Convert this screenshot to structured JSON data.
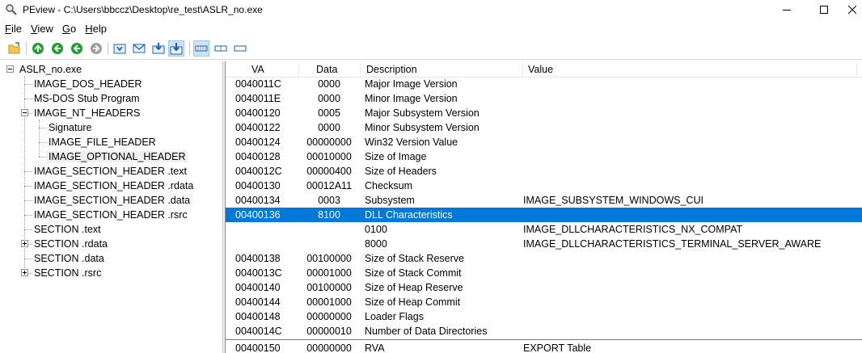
{
  "window": {
    "title": "PEview - C:\\Users\\bbccz\\Desktop\\re_test\\ASLR_no.exe"
  },
  "menu": [
    {
      "label_pre": "",
      "accel": "F",
      "label_post": "ile"
    },
    {
      "label_pre": "",
      "accel": "V",
      "label_post": "iew"
    },
    {
      "label_pre": "",
      "accel": "G",
      "label_post": "o"
    },
    {
      "label_pre": "",
      "accel": "H",
      "label_post": "elp"
    }
  ],
  "toolbar": {
    "icons": [
      "open-folder-icon",
      "go-first-icon",
      "go-back-icon",
      "go-forward-icon",
      "go-last-icon",
      "view-download-icon",
      "view-mail-icon",
      "view-import-icon",
      "view-export-icon",
      "view-bytes-icon",
      "view-words-icon",
      "view-dwords-icon"
    ],
    "accent_color": "#1e9e2e"
  },
  "tree": [
    {
      "label": "ASLR_no.exe",
      "selected": false
    },
    {
      "label": "IMAGE_DOS_HEADER",
      "selected": false
    },
    {
      "label": "MS-DOS Stub Program",
      "selected": false
    },
    {
      "label": "IMAGE_NT_HEADERS",
      "selected": false
    },
    {
      "label": "Signature",
      "selected": false
    },
    {
      "label": "IMAGE_FILE_HEADER",
      "selected": false
    },
    {
      "label": "IMAGE_OPTIONAL_HEADER",
      "selected": true
    },
    {
      "label": "IMAGE_SECTION_HEADER .text",
      "selected": false
    },
    {
      "label": "IMAGE_SECTION_HEADER .rdata",
      "selected": false
    },
    {
      "label": "IMAGE_SECTION_HEADER .data",
      "selected": false
    },
    {
      "label": "IMAGE_SECTION_HEADER .rsrc",
      "selected": false
    },
    {
      "label": "SECTION .text",
      "selected": false
    },
    {
      "label": "SECTION .rdata",
      "selected": false
    },
    {
      "label": "SECTION .data",
      "selected": false
    },
    {
      "label": "SECTION .rsrc",
      "selected": false
    }
  ],
  "table": {
    "headers": {
      "va": "VA",
      "data": "Data",
      "description": "Description",
      "value": "Value"
    },
    "selection_color": "#0078d7",
    "rows": [
      {
        "va": "0040011C",
        "data": "0000",
        "desc": "Major Image Version",
        "value": ""
      },
      {
        "va": "0040011E",
        "data": "0000",
        "desc": "Minor Image Version",
        "value": ""
      },
      {
        "va": "00400120",
        "data": "0005",
        "desc": "Major Subsystem Version",
        "value": ""
      },
      {
        "va": "00400122",
        "data": "0000",
        "desc": "Minor Subsystem Version",
        "value": ""
      },
      {
        "va": "00400124",
        "data": "00000000",
        "desc": "Win32 Version Value",
        "value": ""
      },
      {
        "va": "00400128",
        "data": "00010000",
        "desc": "Size of Image",
        "value": ""
      },
      {
        "va": "0040012C",
        "data": "00000400",
        "desc": "Size of Headers",
        "value": ""
      },
      {
        "va": "00400130",
        "data": "00012A11",
        "desc": "Checksum",
        "value": ""
      },
      {
        "va": "00400134",
        "data": "0003",
        "desc": "Subsystem",
        "value": "IMAGE_SUBSYSTEM_WINDOWS_CUI"
      },
      {
        "va": "00400136",
        "data": "8100",
        "desc": "DLL Characteristics",
        "value": "",
        "selected": true
      },
      {
        "va": "",
        "data": "",
        "desc": "0100",
        "value": "IMAGE_DLLCHARACTERISTICS_NX_COMPAT"
      },
      {
        "va": "",
        "data": "",
        "desc": "8000",
        "value": "IMAGE_DLLCHARACTERISTICS_TERMINAL_SERVER_AWARE"
      },
      {
        "va": "00400138",
        "data": "00100000",
        "desc": "Size of Stack Reserve",
        "value": ""
      },
      {
        "va": "0040013C",
        "data": "00001000",
        "desc": "Size of Stack Commit",
        "value": ""
      },
      {
        "va": "00400140",
        "data": "00100000",
        "desc": "Size of Heap Reserve",
        "value": ""
      },
      {
        "va": "00400144",
        "data": "00001000",
        "desc": "Size of Heap Commit",
        "value": ""
      },
      {
        "va": "00400148",
        "data": "00000000",
        "desc": "Loader Flags",
        "value": ""
      },
      {
        "va": "0040014C",
        "data": "00000010",
        "desc": "Number of Data Directories",
        "value": ""
      },
      {
        "va": "00400150",
        "data": "00000000",
        "desc": "RVA",
        "value": "EXPORT Table"
      }
    ]
  }
}
